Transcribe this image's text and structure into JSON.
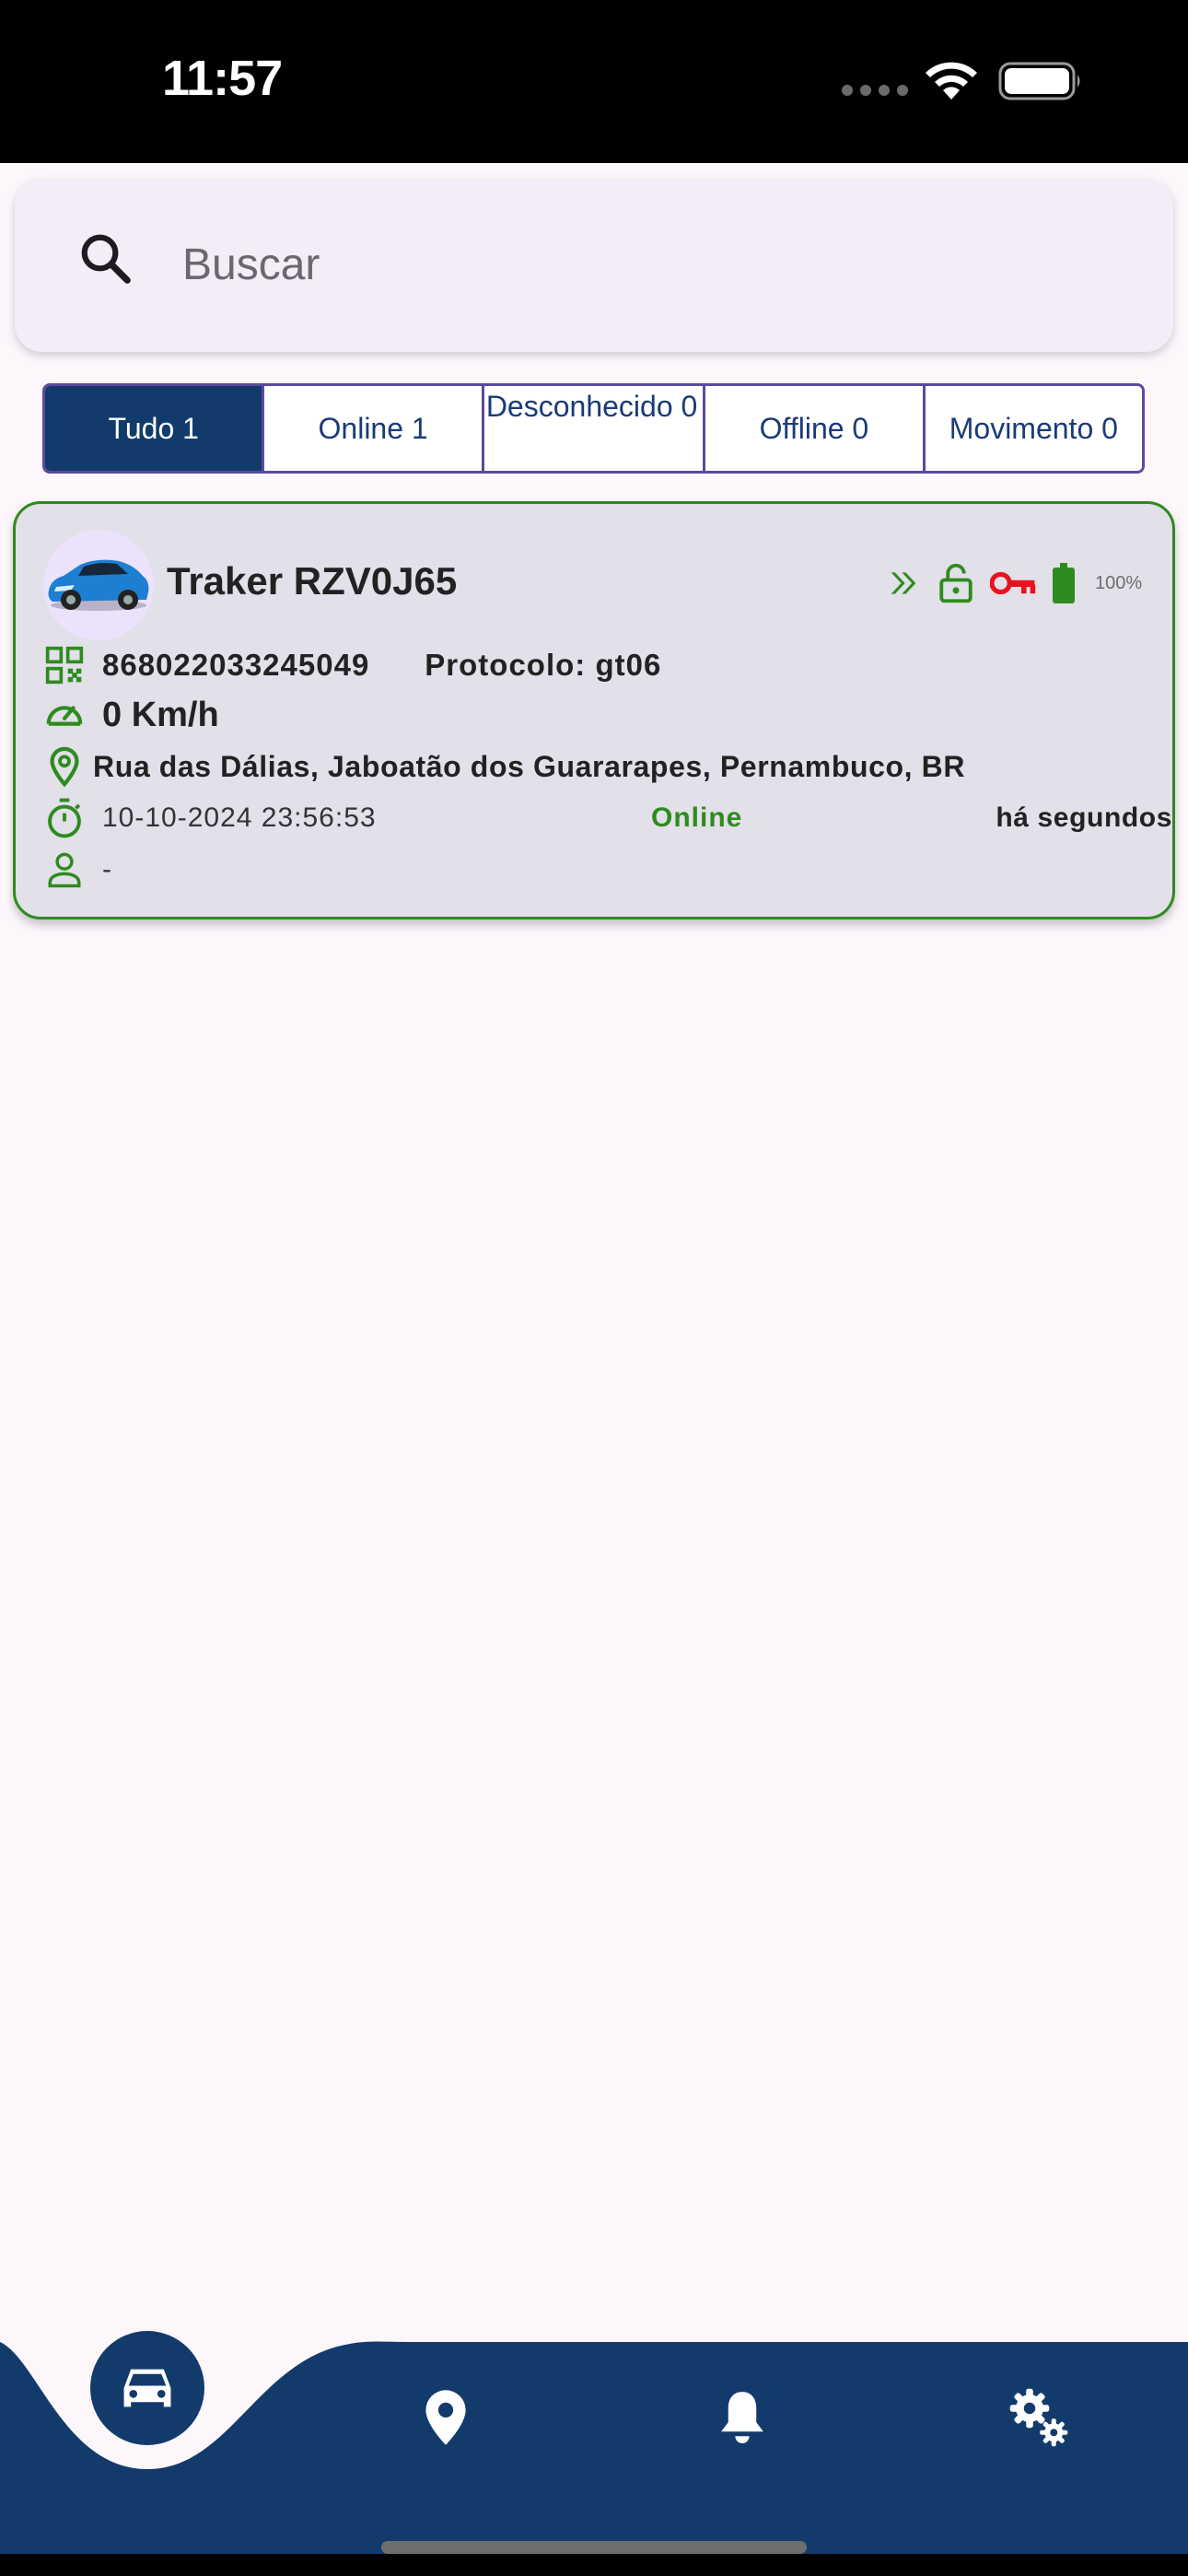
{
  "status_bar": {
    "time": "11:57"
  },
  "search": {
    "placeholder": "Buscar",
    "value": ""
  },
  "filters": [
    {
      "label": "Tudo 1",
      "active": true
    },
    {
      "label": "Online 1",
      "active": false
    },
    {
      "label": "Desconhecido 0",
      "active": false
    },
    {
      "label": "Offline 0",
      "active": false
    },
    {
      "label": "Movimento 0",
      "active": false
    }
  ],
  "vehicle": {
    "name": "Traker RZV0J65",
    "imei": "868022033245049",
    "protocol": "Protocolo: gt06",
    "speed": "0 Km/h",
    "address": "Rua das Dálias, Jaboatão dos Guararapes, Pernambuco, BR",
    "datetime": "10-10-2024 23:56:53",
    "status": "Online",
    "last_update": "há segundos",
    "driver": "-",
    "battery": "100%"
  },
  "icons": {
    "moving": "double-chevron-right-icon",
    "lock": "unlocked-padlock-icon",
    "ignition": "key-icon",
    "battery": "battery-full-icon"
  },
  "colors": {
    "primary": "#123b6c",
    "online_green": "#2e8b1e",
    "ignition_red": "#e8131d",
    "card_bg": "#e2e0e8"
  },
  "nav": {
    "items": [
      "car-icon",
      "map-pin-icon",
      "bell-icon",
      "settings-gears-icon"
    ],
    "active": "car-icon"
  }
}
